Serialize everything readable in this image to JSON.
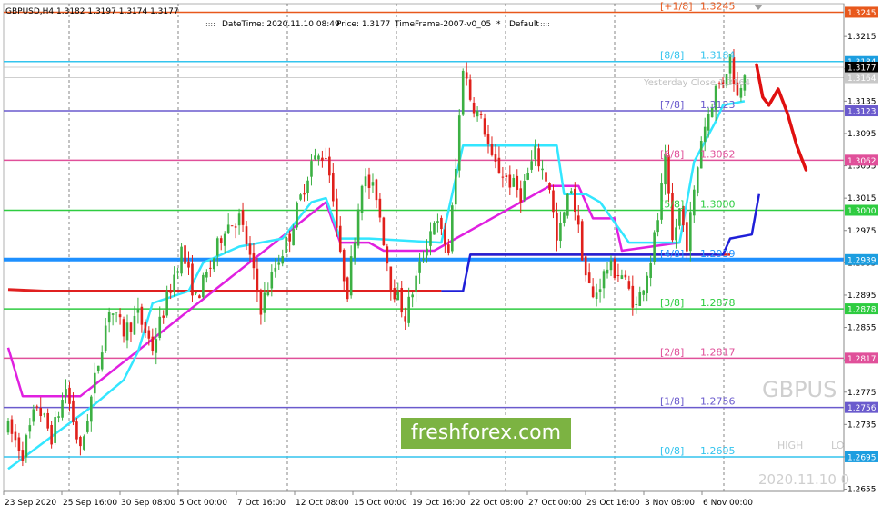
{
  "symbol_header": "GBPUSD,H4  1.3182 1.3197 1.3174 1.3177",
  "info_bar": {
    "datetime": "DateTime: 2020.11.10 08:49",
    "price": "Price: 1.3177",
    "timeframe": "TimeFrame-2007-v0_05",
    "star": "*",
    "default": "Default"
  },
  "watermark_text": "freshforex.com",
  "symbol_watermark": "GBPUS",
  "high_label": "HIGH",
  "low_label": "LO",
  "date_watermark": "2020.11.10 0",
  "yesterday_close_label": "Yesterday Close 1.3164",
  "colors": {
    "bull": "#3cb043",
    "bear": "#e0201b",
    "cyan": "#33e6ff",
    "magenta": "#e020e0",
    "red_line": "#e02020",
    "navy": "#1f1fd8",
    "forecast": "#e01010"
  },
  "chart_data": {
    "type": "candlestick",
    "symbol": "GBPUSD",
    "timeframe": "H4",
    "ohlc_current": {
      "open": 1.3182,
      "high": 1.3197,
      "low": 1.3174,
      "close": 1.3177
    },
    "ylim": [
      1.265,
      1.325
    ],
    "y_ticks": [
      "1.3215",
      "1.3175",
      "1.3135",
      "1.3095",
      "1.3055",
      "1.3015",
      "1.2975",
      "1.2935",
      "1.2895",
      "1.2855",
      "1.2815",
      "1.2775",
      "1.2735",
      "1.2695",
      "1.2655"
    ],
    "x_labels": [
      "23 Sep 2020",
      "25 Sep 16:00",
      "30 Sep 08:00",
      "5 Oct 00:00",
      "7 Oct 16:00",
      "12 Oct 08:00",
      "15 Oct 00:00",
      "19 Oct 16:00",
      "22 Oct 08:00",
      "27 Oct 00:00",
      "29 Oct 16:00",
      "3 Nov 08:00",
      "6 Nov 00:00"
    ],
    "murrey_levels": [
      {
        "label": "[+1/8]",
        "value": "1.3245",
        "price": 1.3245,
        "color": "#e8581c"
      },
      {
        "label": "[8/8]",
        "value": "1.3184",
        "price": 1.3184,
        "color": "#33c4ee"
      },
      {
        "label": "[7/8]",
        "value": "1.3123",
        "price": 1.3123,
        "color": "#6a5acd"
      },
      {
        "label": "[6/8]",
        "value": "1.3062",
        "price": 1.3062,
        "color": "#e0509a"
      },
      {
        "label": "[5/8]",
        "value": "1.3000",
        "price": 1.3,
        "color": "#2ecc40"
      },
      {
        "label": "[4/8]",
        "value": "1.2939",
        "price": 1.2939,
        "color": "#1e90ff"
      },
      {
        "label": "[3/8]",
        "value": "1.2878",
        "price": 1.2878,
        "color": "#2ecc40"
      },
      {
        "label": "[2/8]",
        "value": "1.2817",
        "price": 1.2817,
        "color": "#e0509a"
      },
      {
        "label": "[1/8]",
        "value": "1.2756",
        "price": 1.2756,
        "color": "#6a5acd"
      },
      {
        "label": "[0/8]",
        "value": "1.2695",
        "price": 1.2695,
        "color": "#33c4ee"
      }
    ],
    "price_boxes": [
      {
        "value": "1.3245",
        "price": 1.3245,
        "bg": "#e8581c"
      },
      {
        "value": "1.3184",
        "price": 1.3184,
        "bg": "#1c9ee0"
      },
      {
        "value": "1.3177",
        "price": 1.3177,
        "bg": "#000000"
      },
      {
        "value": "1.3164",
        "price": 1.3164,
        "bg": "#c8c8c8"
      },
      {
        "value": "1.3123",
        "price": 1.3123,
        "bg": "#6a5acd"
      },
      {
        "value": "1.3062",
        "price": 1.3062,
        "bg": "#e0509a"
      },
      {
        "value": "1.3000",
        "price": 1.3,
        "bg": "#2ecc40"
      },
      {
        "value": "1.2939",
        "price": 1.2939,
        "bg": "#1c9ee0"
      },
      {
        "value": "1.2878",
        "price": 1.2878,
        "bg": "#2ecc40"
      },
      {
        "value": "1.2817",
        "price": 1.2817,
        "bg": "#e0509a"
      },
      {
        "value": "1.2756",
        "price": 1.2756,
        "bg": "#6a5acd"
      },
      {
        "value": "1.2695",
        "price": 1.2695,
        "bg": "#1c9ee0"
      }
    ],
    "anchors": [
      [
        0,
        1.273
      ],
      [
        4,
        1.27
      ],
      [
        8,
        1.276
      ],
      [
        12,
        1.272
      ],
      [
        16,
        1.278
      ],
      [
        20,
        1.27
      ],
      [
        24,
        1.279
      ],
      [
        28,
        1.288
      ],
      [
        32,
        1.285
      ],
      [
        36,
        1.287
      ],
      [
        40,
        1.283
      ],
      [
        44,
        1.289
      ],
      [
        48,
        1.295
      ],
      [
        52,
        1.289
      ],
      [
        56,
        1.293
      ],
      [
        60,
        1.298
      ],
      [
        64,
        1.299
      ],
      [
        66,
        1.296
      ],
      [
        70,
        1.288
      ],
      [
        74,
        1.293
      ],
      [
        78,
        1.297
      ],
      [
        82,
        1.303
      ],
      [
        84,
        1.306
      ],
      [
        88,
        1.307
      ],
      [
        90,
        1.302
      ],
      [
        92,
        1.294
      ],
      [
        94,
        1.29
      ],
      [
        98,
        1.304
      ],
      [
        102,
        1.302
      ],
      [
        106,
        1.291
      ],
      [
        110,
        1.287
      ],
      [
        114,
        1.293
      ],
      [
        118,
        1.299
      ],
      [
        122,
        1.295
      ],
      [
        124,
        1.305
      ],
      [
        126,
        1.318
      ],
      [
        128,
        1.314
      ],
      [
        132,
        1.31
      ],
      [
        134,
        1.306
      ],
      [
        138,
        1.304
      ],
      [
        142,
        1.302
      ],
      [
        146,
        1.307
      ],
      [
        150,
        1.303
      ],
      [
        152,
        1.296
      ],
      [
        156,
        1.303
      ],
      [
        160,
        1.292
      ],
      [
        162,
        1.289
      ],
      [
        166,
        1.293
      ],
      [
        170,
        1.292
      ],
      [
        174,
        1.288
      ],
      [
        178,
        1.294
      ],
      [
        180,
        1.299
      ],
      [
        182,
        1.306
      ],
      [
        184,
        1.296
      ],
      [
        186,
        1.3
      ],
      [
        188,
        1.296
      ],
      [
        190,
        1.302
      ],
      [
        192,
        1.309
      ],
      [
        194,
        1.312
      ],
      [
        196,
        1.315
      ],
      [
        198,
        1.316
      ],
      [
        200,
        1.319
      ],
      [
        202,
        1.314
      ],
      [
        204,
        1.3177
      ]
    ],
    "indicator_lines": {
      "cyan": [
        [
          0,
          1.268
        ],
        [
          24,
          1.276
        ],
        [
          32,
          1.279
        ],
        [
          36,
          1.2825
        ],
        [
          40,
          1.2885
        ],
        [
          50,
          1.29
        ],
        [
          54,
          1.2935
        ],
        [
          64,
          1.2955
        ],
        [
          76,
          1.2965
        ],
        [
          84,
          1.301
        ],
        [
          88,
          1.3015
        ],
        [
          92,
          1.2965
        ],
        [
          100,
          1.2965
        ],
        [
          120,
          1.296
        ],
        [
          126,
          1.308
        ],
        [
          146,
          1.308
        ],
        [
          152,
          1.308
        ],
        [
          154,
          1.302
        ],
        [
          160,
          1.302
        ],
        [
          164,
          1.301
        ],
        [
          172,
          1.296
        ],
        [
          186,
          1.296
        ],
        [
          190,
          1.306
        ],
        [
          196,
          1.311
        ],
        [
          198,
          1.313
        ],
        [
          204,
          1.3135
        ]
      ],
      "magenta": [
        [
          0,
          1.283
        ],
        [
          4,
          1.277
        ],
        [
          16,
          1.277
        ],
        [
          20,
          1.277
        ],
        [
          88,
          1.301
        ],
        [
          92,
          1.296
        ],
        [
          100,
          1.296
        ],
        [
          104,
          1.295
        ],
        [
          118,
          1.295
        ],
        [
          150,
          1.303
        ],
        [
          158,
          1.303
        ],
        [
          162,
          1.299
        ],
        [
          168,
          1.299
        ],
        [
          170,
          1.295
        ],
        [
          186,
          1.296
        ]
      ],
      "red": [
        [
          0,
          1.2902
        ],
        [
          10,
          1.29
        ],
        [
          120,
          1.29
        ]
      ],
      "navy": [
        [
          120,
          1.29
        ],
        [
          126,
          1.29
        ],
        [
          128,
          1.2945
        ],
        [
          198,
          1.2945
        ],
        [
          200,
          1.2965
        ],
        [
          206,
          1.297
        ],
        [
          208,
          1.302
        ]
      ],
      "red_flat": [
        [
          128,
          1.2945
        ],
        [
          200,
          1.2945
        ]
      ]
    },
    "forecast": [
      [
        0,
        1.318
      ],
      [
        4,
        1.314
      ],
      [
        8,
        1.313
      ],
      [
        14,
        1.315
      ],
      [
        20,
        1.312
      ],
      [
        26,
        1.308
      ],
      [
        32,
        1.305
      ]
    ],
    "grid": true
  }
}
